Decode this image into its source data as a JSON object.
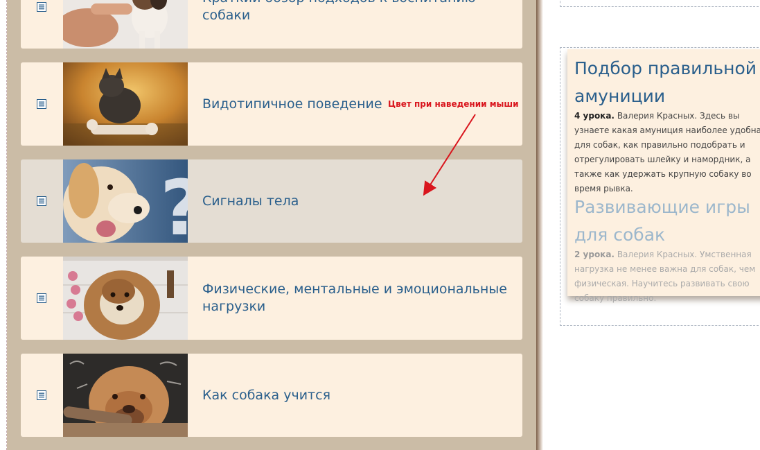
{
  "lessons": [
    {
      "title": "Краткий обзор подходов к воспитанию собаки",
      "thumb": "pointing-finger-puppy"
    },
    {
      "title": "Видотипичное поведение",
      "thumb": "bulldog-with-bone"
    },
    {
      "title": "Сигналы тела",
      "thumb": "puppy-question-mark"
    },
    {
      "title": "Физические, ментальные и эмоциональные нагрузки",
      "thumb": "fluffy-dog-with-toys"
    },
    {
      "title": "Как собака учится",
      "thumb": "mastiff-puppy-chalkboard"
    }
  ],
  "lesson_icon": "document-list-icon",
  "annotation": {
    "text": "Цвет при наведении мыши"
  },
  "courses": [
    {
      "title": "Подбор правильной амуниции",
      "lessons_count": "4 урока.",
      "description": "Валерия Красных. Здесь вы узнаете какая амуниция наиболее удобна для собак, как правильно подобрать и отрегулировать шлейку и намордник, а также как удержать крупную собаку во время рывка."
    },
    {
      "title": "Развивающие игры для собак",
      "lessons_count": "2 урока.",
      "description": "Валерия Красных. Умственная нагрузка не менее важна для собак, чем физическая. Научитесь развивать свою собаку правильно."
    }
  ],
  "colors": {
    "panel": "#cbbca6",
    "row": "#fdf0e0",
    "row_hover": "#e4ddd3",
    "link": "#2a5f8c",
    "annotation": "#d9151d"
  }
}
